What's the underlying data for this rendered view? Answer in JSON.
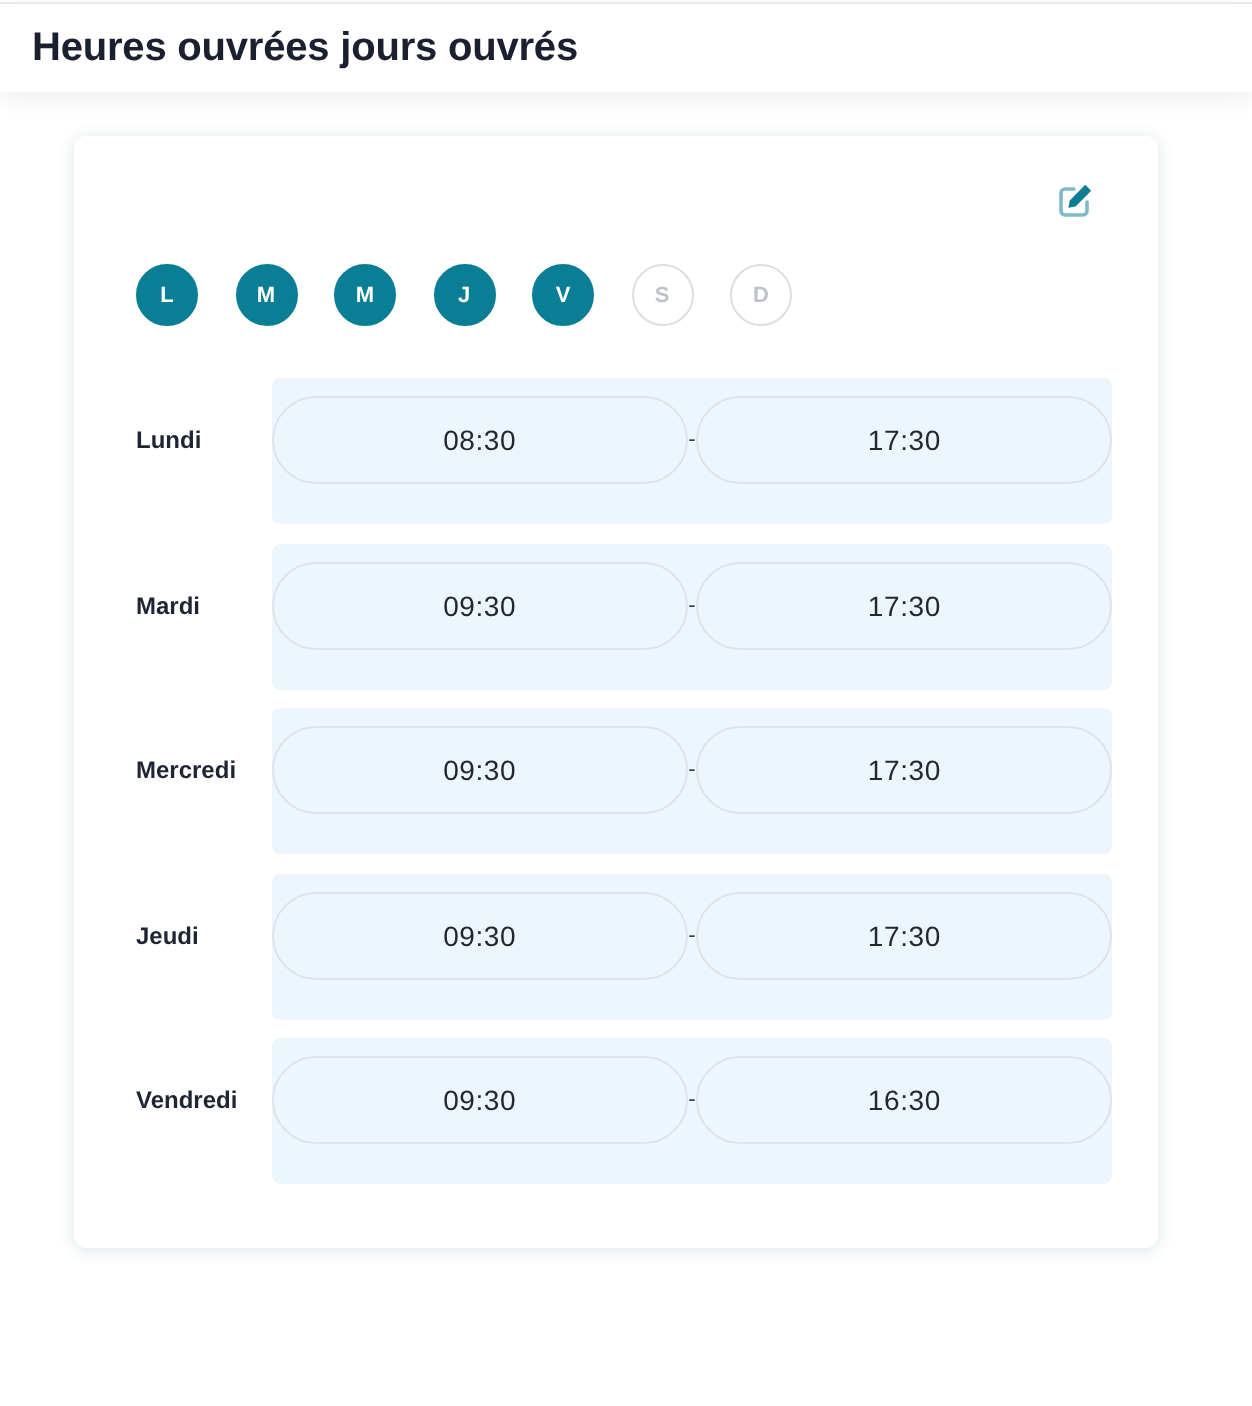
{
  "header": {
    "title": "Heures ouvrées jours ouvrés"
  },
  "weekdays": [
    {
      "label": "L",
      "selected": true
    },
    {
      "label": "M",
      "selected": true
    },
    {
      "label": "M",
      "selected": true
    },
    {
      "label": "J",
      "selected": true
    },
    {
      "label": "V",
      "selected": true
    },
    {
      "label": "S",
      "selected": false
    },
    {
      "label": "D",
      "selected": false
    }
  ],
  "schedule": [
    {
      "day": "Lundi",
      "start": "08:30",
      "separator": "-",
      "end": "17:30"
    },
    {
      "day": "Mardi",
      "start": "09:30",
      "separator": "-",
      "end": "17:30"
    },
    {
      "day": "Mercredi",
      "start": "09:30",
      "separator": "-",
      "end": "17:30"
    },
    {
      "day": "Jeudi",
      "start": "09:30",
      "separator": "-",
      "end": "17:30"
    },
    {
      "day": "Vendredi",
      "start": "09:30",
      "separator": "-",
      "end": "16:30"
    }
  ]
}
